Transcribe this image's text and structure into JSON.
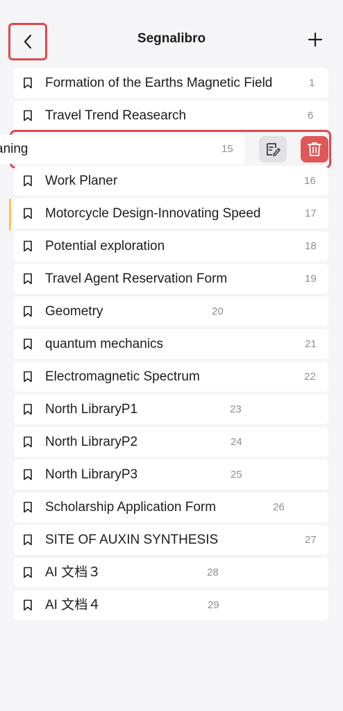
{
  "header": {
    "title": "Segnalibro",
    "back_icon": "chevron-left-icon",
    "add_icon": "plus-icon"
  },
  "swiped": {
    "label": "aning",
    "page": "15",
    "edit_icon": "edit-note-icon",
    "delete_icon": "trash-icon"
  },
  "bookmarks": [
    {
      "label": "Formation of the Earths Magnetic Field",
      "page": "1"
    },
    {
      "label": "Travel Trend Reasearch",
      "page": "6"
    },
    {
      "label": "Work Planer",
      "page": "16"
    },
    {
      "label": "Motorcycle Design-Innovating Speed",
      "page": "17"
    },
    {
      "label": "Potential exploration",
      "page": "18"
    },
    {
      "label": "Travel Agent Reservation Form",
      "page": "19"
    },
    {
      "label": "Geometry",
      "page": "20"
    },
    {
      "label": "quantum mechanics",
      "page": "21"
    },
    {
      "label": "Electromagnetic Spectrum",
      "page": "22"
    },
    {
      "label": "North LibraryP1",
      "page": "23"
    },
    {
      "label": "North LibraryP2",
      "page": "24"
    },
    {
      "label": "North LibraryP3",
      "page": "25"
    },
    {
      "label": "Scholarship Application Form",
      "page": "26"
    },
    {
      "label": "SITE OF AUXIN SYNTHESIS",
      "page": "27"
    },
    {
      "label": "AI 文档３",
      "page": "28"
    },
    {
      "label": "AI 文档４",
      "page": "29"
    }
  ],
  "colors": {
    "highlight_border": "#e0484b",
    "delete_bg": "#e15757",
    "edit_bg": "#e2e2e4",
    "active_marker": "#f2c94c"
  }
}
